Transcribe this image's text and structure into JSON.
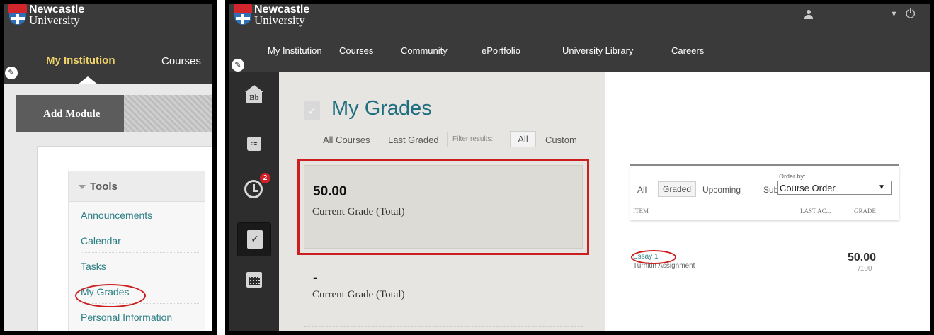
{
  "branding": {
    "line1": "Newcastle",
    "line2": "University"
  },
  "left_panel": {
    "nav": {
      "active": "My Institution",
      "courses": "Courses"
    },
    "add_module": "Add Module",
    "tools": {
      "header": "Tools",
      "items": [
        "Announcements",
        "Calendar",
        "Tasks",
        "My Grades",
        "Personal Information"
      ]
    }
  },
  "right_panel": {
    "nav": [
      "My Institution",
      "Courses",
      "Community",
      "ePortfolio",
      "University Library",
      "Careers"
    ],
    "rail": {
      "notification_count": "2",
      "home_label": "Bb"
    },
    "grades": {
      "title": "My Grades",
      "filters": {
        "all_courses": "All Courses",
        "last_graded": "Last Graded",
        "label": "Filter results:",
        "all": "All",
        "custom": "Custom"
      },
      "cards": [
        {
          "value": "50.00",
          "label": "Current Grade (Total)"
        },
        {
          "value": "-",
          "label": "Current Grade (Total)"
        }
      ]
    },
    "detail": {
      "tabs": [
        "All",
        "Graded",
        "Upcoming",
        "Sub"
      ],
      "order_by_label": "Order by:",
      "order_by_value": "Course Order",
      "columns": [
        "ITEM",
        "LAST AC...",
        "GRADE"
      ],
      "item": {
        "name": "Essay 1",
        "type": "Turnitin Assignment",
        "grade": "50.00",
        "max": "/100"
      }
    }
  },
  "colors": {
    "accent_teal": "#1f6d7f",
    "highlight_red": "#cc1e1e",
    "nav_gold": "#f0d36a"
  }
}
